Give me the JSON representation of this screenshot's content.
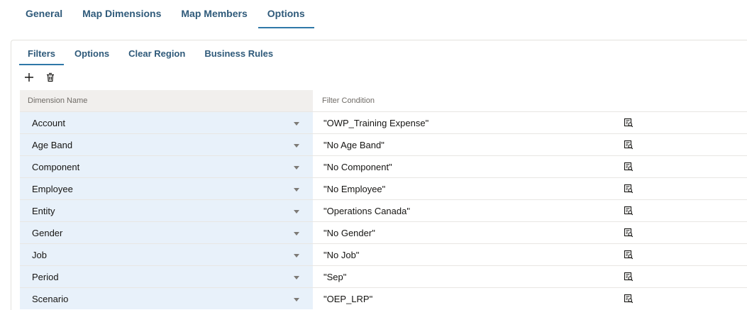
{
  "top_tabs": [
    {
      "label": "General",
      "active": false
    },
    {
      "label": "Map Dimensions",
      "active": false
    },
    {
      "label": "Map Members",
      "active": false
    },
    {
      "label": "Options",
      "active": true
    }
  ],
  "sub_tabs": [
    {
      "label": "Filters",
      "active": true
    },
    {
      "label": "Options",
      "active": false
    },
    {
      "label": "Clear Region",
      "active": false
    },
    {
      "label": "Business Rules",
      "active": false
    }
  ],
  "toolbar": {
    "add_icon": "plus-icon",
    "delete_icon": "trash-icon"
  },
  "table": {
    "headers": {
      "dimension": "Dimension Name",
      "filter": "Filter Condition"
    },
    "rows": [
      {
        "dimension": "Account",
        "filter": "\"OWP_Training Expense\""
      },
      {
        "dimension": "Age Band",
        "filter": "\"No Age Band\""
      },
      {
        "dimension": "Component",
        "filter": "\"No Component\""
      },
      {
        "dimension": "Employee",
        "filter": "\"No Employee\""
      },
      {
        "dimension": "Entity",
        "filter": "\"Operations Canada\""
      },
      {
        "dimension": "Gender",
        "filter": "\"No Gender\""
      },
      {
        "dimension": "Job",
        "filter": "\"No Job\""
      },
      {
        "dimension": "Period",
        "filter": "\"Sep\""
      },
      {
        "dimension": "Scenario",
        "filter": "\"OEP_LRP\""
      }
    ]
  },
  "colors": {
    "accent": "#2f78a8",
    "tab_text": "#2f5a7a",
    "dim_cell_bg": "#e8f1fa"
  }
}
